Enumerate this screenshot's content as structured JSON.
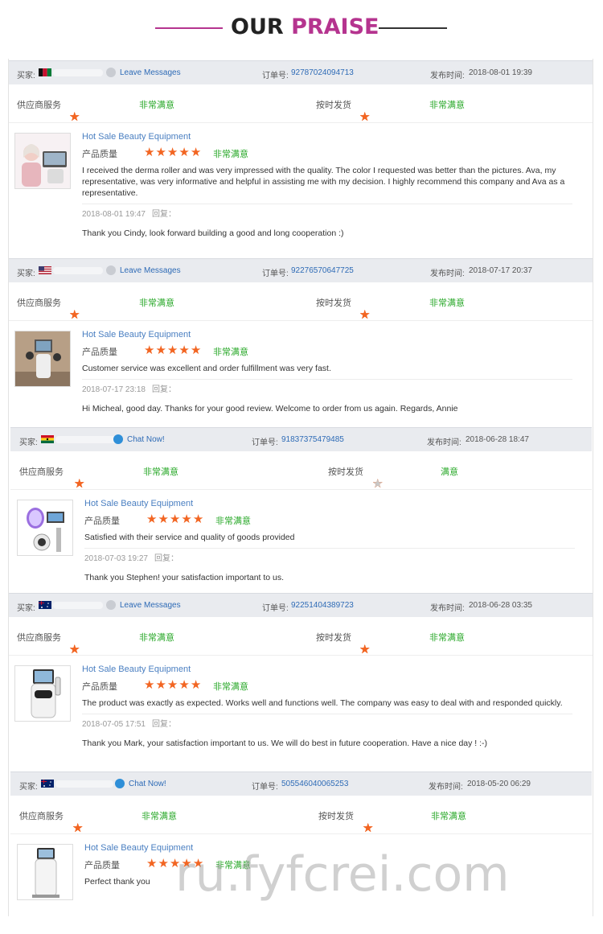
{
  "banner": {
    "title_part1": "OUR",
    "title_part2": "PRAISE"
  },
  "labels": {
    "buyer": "买家:",
    "order": "订单号:",
    "published": "发布时间:",
    "supplier_service": "供应商服务",
    "on_time_delivery": "按时发货",
    "product_quality": "产品质量",
    "reply": "回复："
  },
  "reviews": [
    {
      "message_link": "Leave Messages",
      "order_no": "92787024094713",
      "published_time": "2018-08-01 19:39",
      "supplier_rating_text": "非常满意",
      "delivery_rating_text": "非常满意",
      "product_title": "Hot Sale Beauty Equipment",
      "quality_rating_text": "非常满意",
      "comment": "I received the derma roller and was very impressed with the quality. The color I requested was better than the pictures. Ava, my representative, was very informative and helpful in assisting me with my decision. I highly recommend this company and Ava as a representative.",
      "reply_time": "2018-08-01 19:47",
      "reply": "Thank you Cindy, look forward building a good and long cooperation :)"
    },
    {
      "message_link": "Leave Messages",
      "order_no": "92276570647725",
      "published_time": "2018-07-17 20:37",
      "supplier_rating_text": "非常满意",
      "delivery_rating_text": "非常满意",
      "product_title": "Hot Sale Beauty Equipment",
      "quality_rating_text": "非常满意",
      "comment": "Customer service was excellent and order fulfillment was very fast.",
      "reply_time": "2018-07-17 23:18",
      "reply": "Hi Micheal, good day. Thanks for your good review. Welcome to order from us again. Regards, Annie"
    },
    {
      "message_link": "Chat Now!",
      "order_no": "91837375479485",
      "published_time": "2018-06-28 18:47",
      "supplier_rating_text": "非常满意",
      "delivery_rating_text": "满意",
      "product_title": "Hot Sale Beauty Equipment",
      "quality_rating_text": "非常满意",
      "comment": "Satisfied with their service and quality of goods provided",
      "reply_time": "2018-07-03 19:27",
      "reply": "Thank you Stephen! your satisfaction important to us."
    },
    {
      "message_link": "Leave Messages",
      "order_no": "92251404389723",
      "published_time": "2018-06-28 03:35",
      "supplier_rating_text": "非常满意",
      "delivery_rating_text": "非常满意",
      "product_title": "Hot Sale Beauty Equipment",
      "quality_rating_text": "非常满意",
      "comment": "The product was exactly as expected. Works well and functions well. The company was easy to deal with and responded quickly.",
      "reply_time": "2018-07-05 17:51",
      "reply": "Thank you Mark, your satisfaction important to us. We will do best in future cooperation. Have a nice day ! :-)"
    },
    {
      "message_link": "Chat Now!",
      "order_no": "505546040065253",
      "published_time": "2018-05-20 06:29",
      "supplier_rating_text": "非常满意",
      "delivery_rating_text": "非常满意",
      "product_title": "Hot Sale Beauty Equipment",
      "quality_rating_text": "非常满意",
      "comment": "Perfect thank you"
    }
  ],
  "ratings": {
    "max_stars": 5,
    "review_1": {
      "supplier": 5,
      "delivery": 5,
      "quality": 5
    },
    "review_2": {
      "supplier": 5,
      "delivery": 5,
      "quality": 5
    },
    "review_3": {
      "supplier": 5,
      "delivery": 4,
      "quality": 5
    },
    "review_4": {
      "supplier": 5,
      "delivery": 5,
      "quality": 5
    },
    "review_5": {
      "supplier": 5,
      "delivery": 5,
      "quality": 5
    }
  },
  "watermark": "ru.fyfcrei.com",
  "colors": {
    "accent": "#b5348f",
    "star": "#f26522",
    "satisfied": "#29a829",
    "link": "#2e6bb6"
  }
}
